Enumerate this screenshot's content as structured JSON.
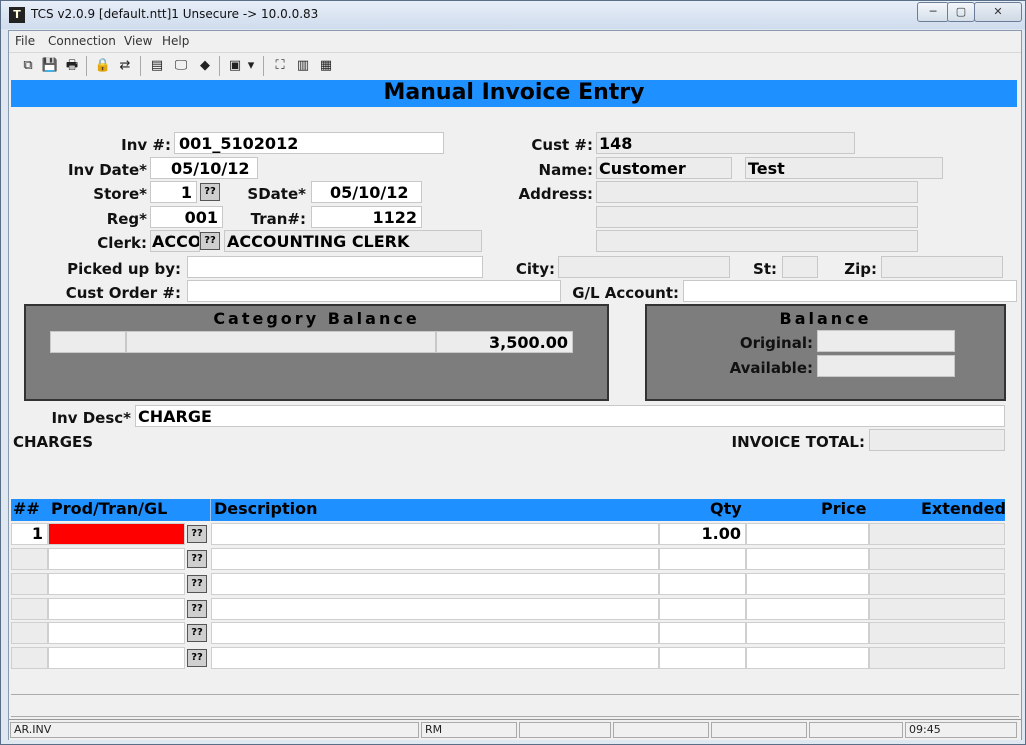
{
  "window": {
    "title": "TCS v2.0.9 [default.ntt]1 Unsecure -> 10.0.0.83",
    "app_icon": "T",
    "min_glyph": "─",
    "max_glyph": "▢",
    "close_glyph": "✕"
  },
  "menu": {
    "items": [
      "File",
      "Connection",
      "View",
      "Help"
    ]
  },
  "toolbar": {
    "icons": [
      "copy-icon",
      "save-icon",
      "print-icon",
      "lock-icon",
      "connect-icon",
      "properties-icon",
      "monitor-icon",
      "eraser-icon",
      "window-dropdown-icon",
      "tree-icon",
      "chart-icon",
      "calculator-icon"
    ],
    "glyphs": [
      "⧉",
      "💾",
      "🖶",
      "🔒",
      "⇄",
      "▤",
      "🖵",
      "◆",
      "▣",
      "⛶",
      "▥",
      "▦"
    ],
    "dropdown_glyph": "▾"
  },
  "form": {
    "title": "Manual Invoice Entry",
    "lookup_label": "??",
    "inv_num": {
      "label": "Inv #:",
      "value": "001_5102012"
    },
    "inv_date": {
      "label": "Inv Date*",
      "value": "05/10/12"
    },
    "store": {
      "label": "Store*",
      "value": "1"
    },
    "sdate": {
      "label": "SDate*",
      "value": "05/10/12"
    },
    "reg": {
      "label": "Reg*",
      "value": "001"
    },
    "tran": {
      "label": "Tran#:",
      "value": "1122"
    },
    "clerk": {
      "label": "Clerk:",
      "code": "ACCO",
      "name": "ACCOUNTING CLERK"
    },
    "picked_up_by": {
      "label": "Picked up by:",
      "value": ""
    },
    "cust_order": {
      "label": "Cust Order #:",
      "value": ""
    },
    "cust_num": {
      "label": "Cust #:",
      "value": "148"
    },
    "name": {
      "label": "Name:",
      "first": "Customer",
      "last": "Test"
    },
    "address": {
      "label": "Address:",
      "lines": [
        "",
        "",
        ""
      ]
    },
    "city": {
      "label": "City:",
      "value": ""
    },
    "st": {
      "label": "St:",
      "value": ""
    },
    "zip": {
      "label": "Zip:",
      "value": ""
    },
    "gl_account": {
      "label": "G/L Account:",
      "value": ""
    },
    "category_balance": {
      "title": "Category Balance",
      "amount": "3,500.00"
    },
    "balance": {
      "title": "Balance",
      "original_label": "Original:",
      "original_value": "",
      "available_label": "Available:",
      "available_value": ""
    },
    "inv_desc": {
      "label": "Inv Desc*",
      "value": "CHARGE"
    },
    "charges_label": "CHARGES",
    "invoice_total": {
      "label": "INVOICE TOTAL:",
      "value": ""
    }
  },
  "grid": {
    "columns": [
      "##",
      "Prod/Tran/GL",
      "Description",
      "Qty",
      "Price",
      "Extended"
    ],
    "rows": [
      {
        "num": "1",
        "prod": "",
        "description": "",
        "qty": "1.00",
        "price": "",
        "extended": ""
      },
      {
        "num": "",
        "prod": "",
        "description": "",
        "qty": "",
        "price": "",
        "extended": ""
      },
      {
        "num": "",
        "prod": "",
        "description": "",
        "qty": "",
        "price": "",
        "extended": ""
      },
      {
        "num": "",
        "prod": "",
        "description": "",
        "qty": "",
        "price": "",
        "extended": ""
      },
      {
        "num": "",
        "prod": "",
        "description": "",
        "qty": "",
        "price": "",
        "extended": ""
      },
      {
        "num": "",
        "prod": "",
        "description": "",
        "qty": "",
        "price": "",
        "extended": ""
      }
    ]
  },
  "status": {
    "module": "AR.INV",
    "mode": "RM",
    "time": "09:45"
  },
  "colors": {
    "banner": "#1e90ff",
    "panel": "#7d7d7d",
    "active_cell": "#ff0000"
  }
}
